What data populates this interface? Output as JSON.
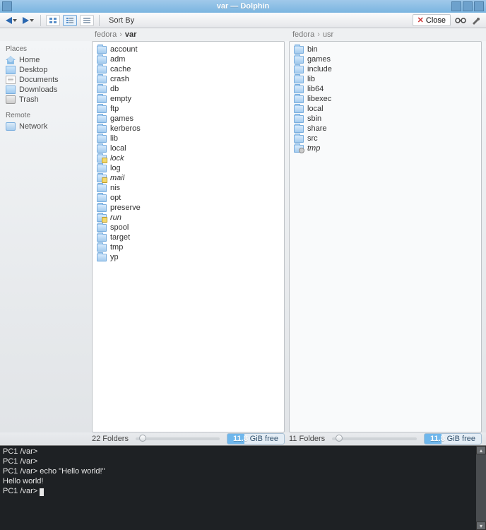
{
  "window": {
    "title": "var — Dolphin"
  },
  "toolbar": {
    "sort_by": "Sort By",
    "close": "Close"
  },
  "breadcrumbs": {
    "left": {
      "root": "fedora",
      "current": "var"
    },
    "right": {
      "root": "fedora",
      "current": "usr"
    }
  },
  "sidebar": {
    "places_header": "Places",
    "remote_header": "Remote",
    "places": [
      {
        "label": "Home",
        "icon": "home"
      },
      {
        "label": "Desktop",
        "icon": "desktop"
      },
      {
        "label": "Documents",
        "icon": "doc"
      },
      {
        "label": "Downloads",
        "icon": "dl"
      },
      {
        "label": "Trash",
        "icon": "trash"
      }
    ],
    "remote": [
      {
        "label": "Network",
        "icon": "net"
      }
    ]
  },
  "pane_left": {
    "folders": [
      {
        "name": "account"
      },
      {
        "name": "adm"
      },
      {
        "name": "cache"
      },
      {
        "name": "crash"
      },
      {
        "name": "db"
      },
      {
        "name": "empty"
      },
      {
        "name": "ftp"
      },
      {
        "name": "games"
      },
      {
        "name": "kerberos"
      },
      {
        "name": "lib"
      },
      {
        "name": "local"
      },
      {
        "name": "lock",
        "italic": true,
        "variant": "locked"
      },
      {
        "name": "log"
      },
      {
        "name": "mail",
        "italic": true,
        "variant": "locked"
      },
      {
        "name": "nis"
      },
      {
        "name": "opt"
      },
      {
        "name": "preserve"
      },
      {
        "name": "run",
        "italic": true,
        "variant": "locked"
      },
      {
        "name": "spool"
      },
      {
        "name": "target"
      },
      {
        "name": "tmp"
      },
      {
        "name": "yp"
      }
    ],
    "status_count": "22 Folders",
    "free": "11.8",
    "free_unit": "GiB free"
  },
  "pane_right": {
    "folders": [
      {
        "name": "bin"
      },
      {
        "name": "games"
      },
      {
        "name": "include"
      },
      {
        "name": "lib"
      },
      {
        "name": "lib64"
      },
      {
        "name": "libexec"
      },
      {
        "name": "local"
      },
      {
        "name": "sbin"
      },
      {
        "name": "share"
      },
      {
        "name": "src"
      },
      {
        "name": "tmp",
        "italic": true,
        "variant": "temp"
      }
    ],
    "status_count": "11 Folders",
    "free": "11.8",
    "free_unit": "GiB free"
  },
  "terminal": {
    "lines": [
      "PC1 /var>",
      "PC1 /var>",
      "PC1 /var> echo \"Hello world!\"",
      "Hello world!",
      "PC1 /var> "
    ]
  }
}
